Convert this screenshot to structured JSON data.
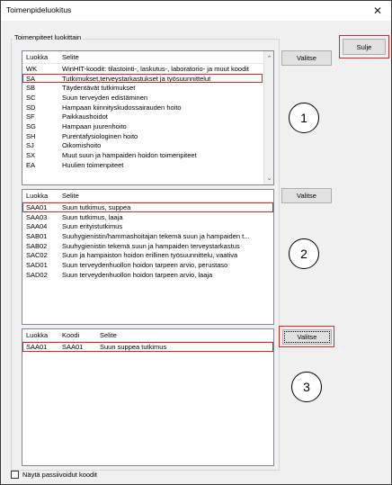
{
  "window": {
    "title": "Toimenpideluokitus",
    "close_symbol": "✕"
  },
  "group_label": "Toimenpiteet luokittain",
  "buttons": {
    "close": "Sulje",
    "select1": "Valitse",
    "select2": "Valitse",
    "select3": "Valitse"
  },
  "list1": {
    "headers": [
      "Luokka",
      "Selite"
    ],
    "rows": [
      [
        "WK",
        "WinHIT-koodit: tilastointi-, laskutus-, laboratorio- ja muut koodit"
      ],
      [
        "SA",
        "Tutkimukset,terveystarkastukset ja työsuunnittelut"
      ],
      [
        "SB",
        "Täydentävät tutkimukset"
      ],
      [
        "SC",
        "Suun terveyden edistäminen"
      ],
      [
        "SD",
        "Hampaan kiinnityskudossairauden hoito"
      ],
      [
        "SF",
        "Paikkaushoidot"
      ],
      [
        "SG",
        "Hampaan juurenhoito"
      ],
      [
        "SH",
        "Purentafysiologinen hoito"
      ],
      [
        "SJ",
        "Oikomishoito"
      ],
      [
        "SX",
        "Muut suun ja hampaiden hoidon toimenpiteet"
      ],
      [
        "EA",
        "Huulien toimenpiteet"
      ]
    ]
  },
  "list2": {
    "headers": [
      "Luokka",
      "Selite"
    ],
    "rows": [
      [
        "SAA01",
        "Suun tutkimus, suppea"
      ],
      [
        "SAA03",
        "Suun tutkimus, laaja"
      ],
      [
        "SAA04",
        "Suun erityistutkimus"
      ],
      [
        "SAB01",
        "Suuhygienistin/hammashoitajan tekemä suun ja hampaiden t..."
      ],
      [
        "SAB02",
        "Suuhygienistin tekemä suun ja hampaiden terveystarkastus"
      ],
      [
        "SAC02",
        "Suun ja hampaiston hoidon erillinen työsuunnittelu, vaativa"
      ],
      [
        "SAD01",
        "Suun terveydenhuollon hoidon tarpeen arvio, perustaso"
      ],
      [
        "SAD02",
        "Suun terveydenhuollon hoidon tarpeen arvio, laaja"
      ]
    ]
  },
  "list3": {
    "headers": [
      "Luokka",
      "Koodi",
      "Selite"
    ],
    "rows": [
      [
        "SAA01",
        "SAA01",
        "Suun suppea tutkimus"
      ]
    ]
  },
  "annotations": [
    "1",
    "2",
    "3"
  ],
  "checkbox_label": "Näytä passiivoidut koodit"
}
